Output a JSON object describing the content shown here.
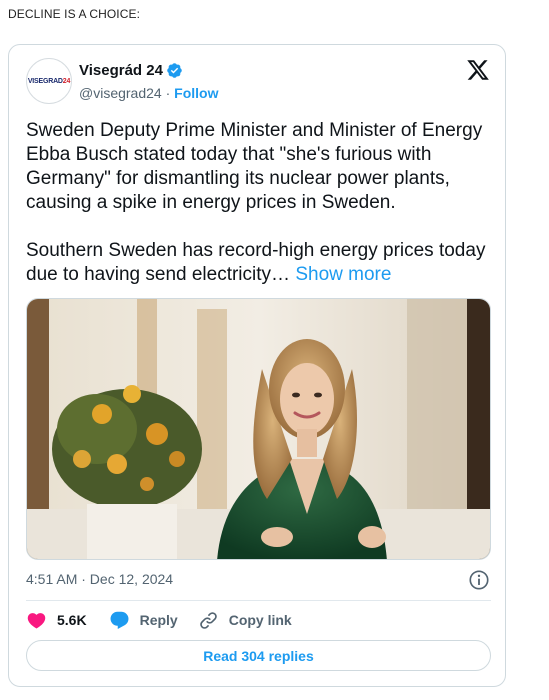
{
  "post": {
    "caption": "DECLINE IS A CHOICE:"
  },
  "tweet": {
    "display_name": "Visegrád 24",
    "handle": "@visegrad24",
    "separator": " · ",
    "follow_label": "Follow",
    "avatar_logo": {
      "main": "VISEGRAD",
      "accent": "24"
    },
    "paragraphs": [
      "Sweden Deputy Prime Minister and Minister of Energy Ebba Busch stated today that \"she's furious with Germany\" for dismantling its nuclear power plants, causing a spike in energy prices in Sweden.",
      "Southern Sweden has record-high energy prices today due to having send electricity…"
    ],
    "show_more_label": "Show more",
    "timestamp": "4:51 AM · Dec 12, 2024",
    "likes_count": "5.6K",
    "reply_label": "Reply",
    "copy_link_label": "Copy link",
    "read_replies_label": "Read 304 replies"
  },
  "colors": {
    "accent": "#1d9bf0",
    "like": "#f91880",
    "muted": "#536471",
    "border": "#cfd9de"
  },
  "icons": [
    "verified-badge-icon",
    "x-logo-icon",
    "info-icon",
    "heart-icon",
    "reply-bubble-icon",
    "link-icon"
  ]
}
